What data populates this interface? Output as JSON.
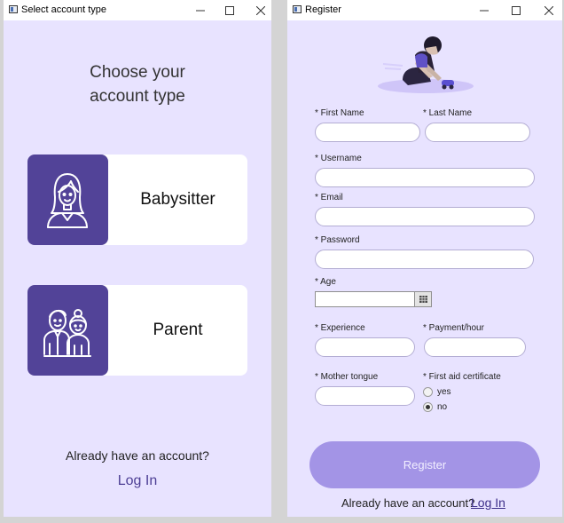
{
  "left_window": {
    "title": "Select account type",
    "heading_line1": "Choose your",
    "heading_line2": "account type",
    "babysitter_label": "Babysitter",
    "parent_label": "Parent",
    "already_text": "Already have an account?",
    "login_label": "Log In"
  },
  "right_window": {
    "title": "Register",
    "fields": {
      "first_name_label": "* First Name",
      "last_name_label": "* Last Name",
      "username_label": "* Username",
      "email_label": "* Email",
      "password_label": "* Password",
      "age_label": "* Age",
      "experience_label": "* Experience",
      "payment_label": "* Payment/hour",
      "mother_tongue_label": "* Mother tongue",
      "first_aid_label": "* First aid certificate"
    },
    "values": {
      "first_name": "",
      "last_name": "",
      "username": "",
      "email": "",
      "password": "",
      "age": "",
      "experience": "",
      "payment": "",
      "mother_tongue": ""
    },
    "first_aid_options": [
      {
        "label": "yes",
        "selected": false
      },
      {
        "label": "no",
        "selected": true
      }
    ],
    "register_label": "Register",
    "already_text": "Already have an account?",
    "login_label": "Log In"
  },
  "window_controls": {
    "minimize": "–",
    "maximize": "☐",
    "close": "✕"
  },
  "colors": {
    "background": "#e8e3ff",
    "accent": "#524398",
    "register_button": "#a394e6",
    "link": "#4d3f95"
  },
  "icons": [
    "app-window-icon",
    "babysitter-icon",
    "parent-icon",
    "calendar-icon",
    "child-playing-illustration"
  ]
}
